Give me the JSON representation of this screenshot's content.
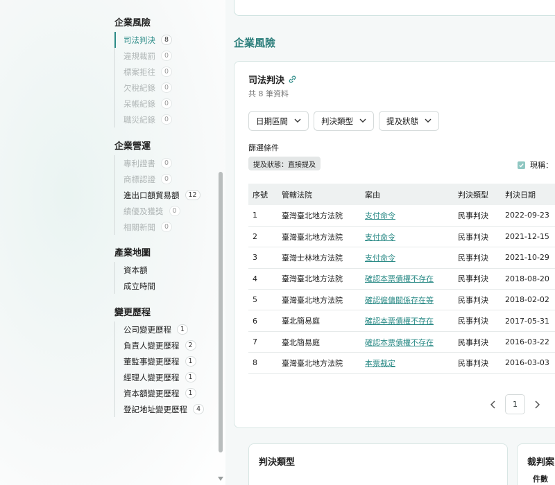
{
  "sidebar": {
    "risk": {
      "title": "企業風險",
      "items": [
        {
          "label": "司法判決",
          "count": "8",
          "state": "active"
        },
        {
          "label": "違規裁罰",
          "count": "0",
          "state": "muted"
        },
        {
          "label": "標案拒往",
          "count": "0",
          "state": "muted"
        },
        {
          "label": "欠稅紀錄",
          "count": "0",
          "state": "muted"
        },
        {
          "label": "呆帳紀錄",
          "count": "0",
          "state": "muted"
        },
        {
          "label": "職災紀錄",
          "count": "0",
          "state": "muted"
        }
      ]
    },
    "operations": {
      "title": "企業營運",
      "items": [
        {
          "label": "專利證書",
          "count": "0",
          "state": "muted"
        },
        {
          "label": "商標認證",
          "count": "0",
          "state": "muted"
        },
        {
          "label": "進出口額貿易額",
          "count": "12",
          "state": "dark"
        },
        {
          "label": "績優及獲獎",
          "count": "0",
          "state": "muted"
        },
        {
          "label": "相關新聞",
          "count": "0",
          "state": "muted"
        }
      ]
    },
    "industry": {
      "title": "產業地圖",
      "items": [
        {
          "label": "資本額",
          "count": null,
          "state": "dark"
        },
        {
          "label": "成立時間",
          "count": null,
          "state": "dark"
        }
      ]
    },
    "history": {
      "title": "變更歷程",
      "items": [
        {
          "label": "公司變更歷程",
          "count": "1",
          "state": "dark"
        },
        {
          "label": "負責人變更歷程",
          "count": "2",
          "state": "dark"
        },
        {
          "label": "董監事變更歷程",
          "count": "1",
          "state": "dark"
        },
        {
          "label": "經理人變更歷程",
          "count": "1",
          "state": "dark"
        },
        {
          "label": "資本額變更歷程",
          "count": "1",
          "state": "dark"
        },
        {
          "label": "登記地址變更歷程",
          "count": "4",
          "state": "dark"
        }
      ]
    }
  },
  "main": {
    "section_heading": "企業風險",
    "card": {
      "title": "司法判決",
      "subtitle": "共 8 筆資料",
      "filters": [
        "日期區間",
        "判決類型",
        "提及狀態"
      ],
      "filter_label": "篩選條件",
      "chip": "提及狀態：直接提及",
      "checkbox_label": "現稱：",
      "columns": [
        "序號",
        "管轄法院",
        "案由",
        "判決類型",
        "判決日期"
      ],
      "rows": [
        [
          "1",
          "臺灣臺北地方法院",
          "支付命令",
          "民事判決",
          "2022-09-23"
        ],
        [
          "2",
          "臺灣臺北地方法院",
          "支付命令",
          "民事判決",
          "2021-12-15"
        ],
        [
          "3",
          "臺灣士林地方法院",
          "支付命令",
          "民事判決",
          "2021-10-29"
        ],
        [
          "4",
          "臺灣臺北地方法院",
          "確認本票債權不存在",
          "民事判決",
          "2018-08-20"
        ],
        [
          "5",
          "臺灣臺北地方法院",
          "確認僱傭關係存在等",
          "民事判決",
          "2018-02-02"
        ],
        [
          "6",
          "臺北簡易庭",
          "確認本票債權不存在",
          "民事判決",
          "2017-05-31"
        ],
        [
          "7",
          "臺北簡易庭",
          "確認本票債權不存在",
          "民事判決",
          "2016-03-22"
        ],
        [
          "8",
          "臺灣臺北地方法院",
          "本票裁定",
          "民事判決",
          "2016-03-03"
        ]
      ],
      "page": "1"
    },
    "bottom_left_title": "判決類型",
    "bottom_right_title": "裁判案",
    "bottom_right_sub": "件數"
  },
  "colors": {
    "accent": "#2a8a86",
    "heading": "#2a7d7a"
  }
}
